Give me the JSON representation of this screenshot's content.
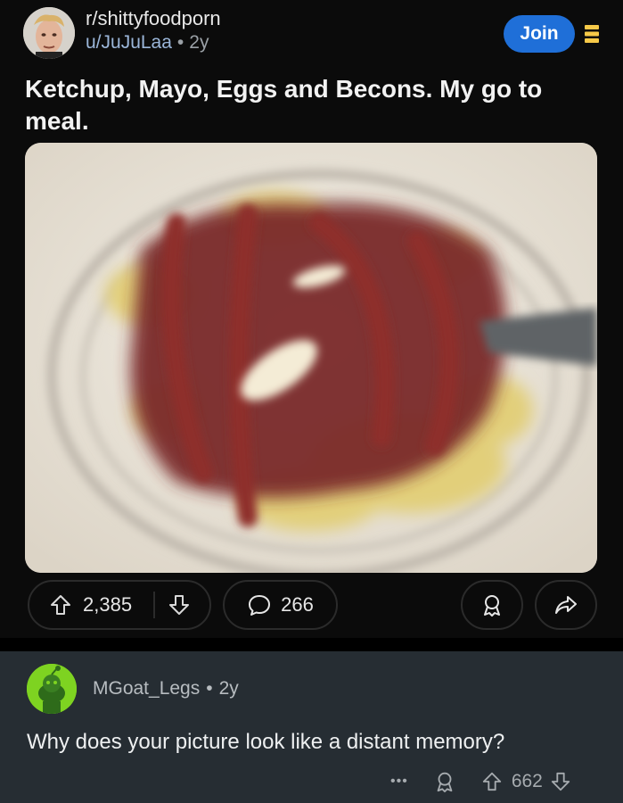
{
  "post": {
    "subreddit": "r/shittyfoodporn",
    "username": "u/JuJuLaa",
    "separator": "•",
    "age": "2y",
    "join_label": "Join",
    "title": "Ketchup, Mayo, Eggs and Becons. My go to meal.",
    "upvotes": "2,385",
    "comments": "266",
    "icons": {
      "more": "more-vertical-icon",
      "upvote": "upvote-arrow-icon",
      "downvote": "downvote-arrow-icon",
      "comment": "comment-bubble-icon",
      "award": "award-icon",
      "share": "share-arrow-icon"
    }
  },
  "comment": {
    "username": "MGoat_Legs",
    "separator": "•",
    "age": "2y",
    "text": "Why does your picture look like a distant memory?",
    "more": "•••",
    "votes": "662"
  },
  "colors": {
    "join": "#1f6fd8",
    "more_icon": "#f7c948",
    "post_bg": "#0b0b0b",
    "comment_bg": "#262d33",
    "username_link": "#9bb6d9",
    "commenter_avatar": "#7ed321"
  }
}
